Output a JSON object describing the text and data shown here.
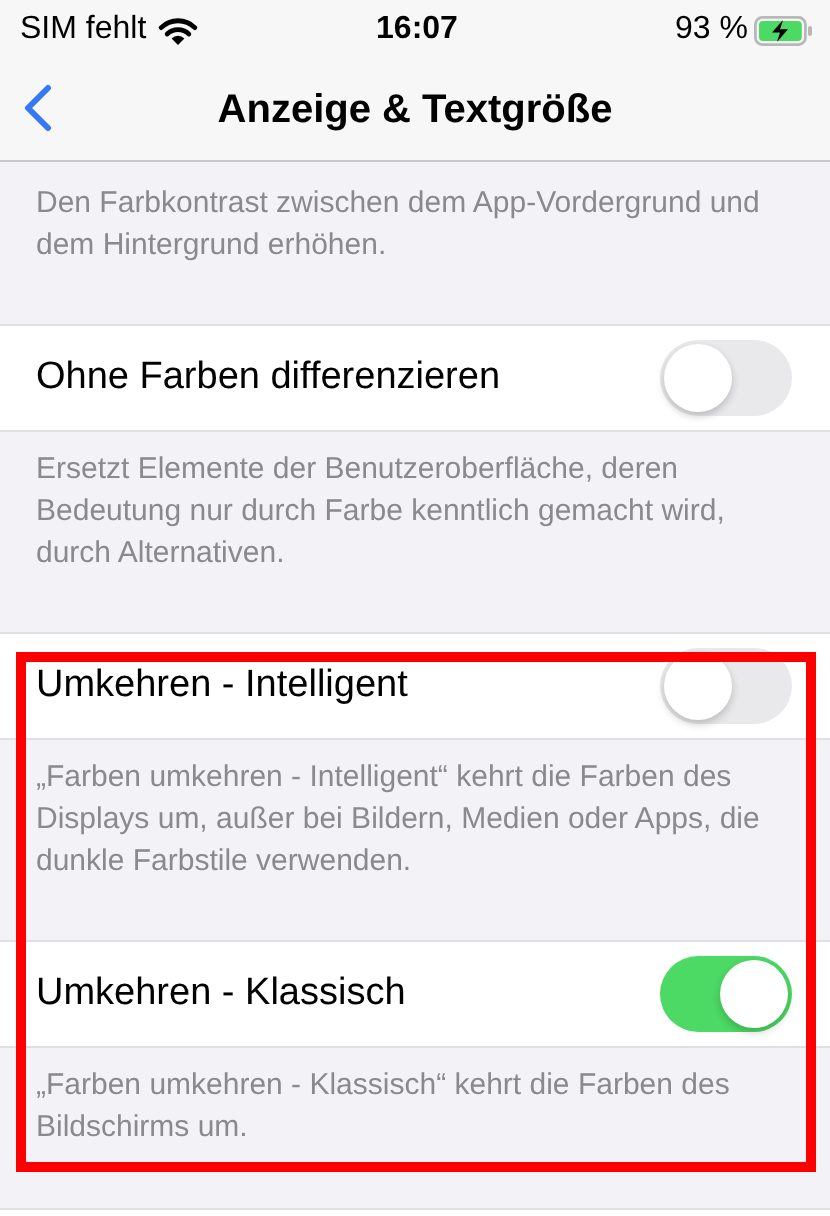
{
  "status_bar": {
    "carrier": "SIM fehlt",
    "time": "16:07",
    "battery": "93 %",
    "charging": true
  },
  "nav": {
    "title": "Anzeige & Textgröße"
  },
  "top_footer": "Den Farbkontrast zwischen dem App-Vordergrund und dem Hintergrund erhöhen.",
  "settings": [
    {
      "label": "Ohne Farben differenzieren",
      "on": false,
      "highlighted": false,
      "footer": "Ersetzt Elemente der Benutzeroberfläche, deren Bedeutung nur durch Farbe kenntlich gemacht wird, durch Alternativen."
    },
    {
      "label": "Umkehren - Intelligent",
      "on": false,
      "highlighted": true,
      "footer": "„Farben umkehren - Intelligent“ kehrt die Farben des Displays um, außer bei Bildern, Medien oder Apps, die dunkle Farbstile verwenden."
    },
    {
      "label": "Umkehren - Klassisch",
      "on": true,
      "highlighted": true,
      "footer": "„Farben umkehren - Klassisch“ kehrt die Farben des Bildschirms um."
    }
  ]
}
